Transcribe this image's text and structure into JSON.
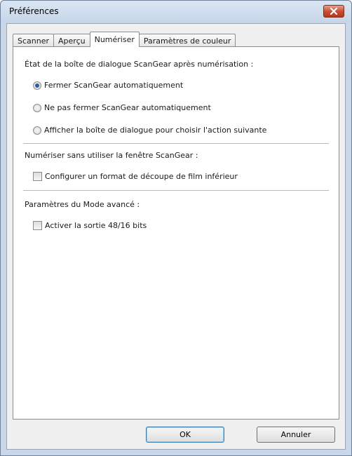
{
  "window": {
    "title": "Préférences"
  },
  "tabs": [
    {
      "label": "Scanner"
    },
    {
      "label": "Aperçu"
    },
    {
      "label": "Numériser",
      "active": true
    },
    {
      "label": "Paramètres de couleur"
    }
  ],
  "section_dialog_state": {
    "label": "État de la boîte de dialogue ScanGear après numérisation :",
    "options": [
      {
        "label": "Fermer ScanGear automatiquement",
        "checked": true
      },
      {
        "label": "Ne pas fermer ScanGear automatiquement",
        "checked": false
      },
      {
        "label": "Afficher la boîte de dialogue pour choisir l'action suivante",
        "checked": false
      }
    ]
  },
  "section_scan_without": {
    "label": "Numériser sans utiliser la fenêtre ScanGear :",
    "checkbox": {
      "label": "Configurer un format de découpe de film inférieur",
      "checked": false
    }
  },
  "section_advanced": {
    "label": "Paramètres du Mode avancé :",
    "checkbox": {
      "label": "Activer la sortie 48/16 bits",
      "checked": false
    }
  },
  "buttons": {
    "ok": "OK",
    "cancel": "Annuler"
  },
  "colors": {
    "titlebar": "#c5d5e8",
    "close_button": "#c74a30",
    "focus": "#3c7fb1"
  }
}
